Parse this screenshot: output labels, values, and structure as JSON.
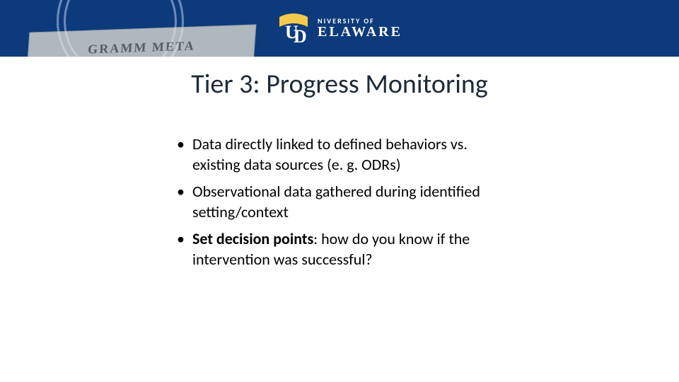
{
  "header": {
    "org_top": "NIVERSITY OF",
    "org_main": "ELAWARE",
    "ribbon_text": "GRAMM   META"
  },
  "title": "Tier 3: Progress Monitoring",
  "bullets": [
    {
      "plain": "Data directly linked to defined behaviors vs. existing data sources (e. g. ODRs)"
    },
    {
      "plain": "Observational data gathered during identified setting/context"
    },
    {
      "bold": "Set decision points",
      "plain": ":  how do you know if the intervention was successful?"
    }
  ]
}
